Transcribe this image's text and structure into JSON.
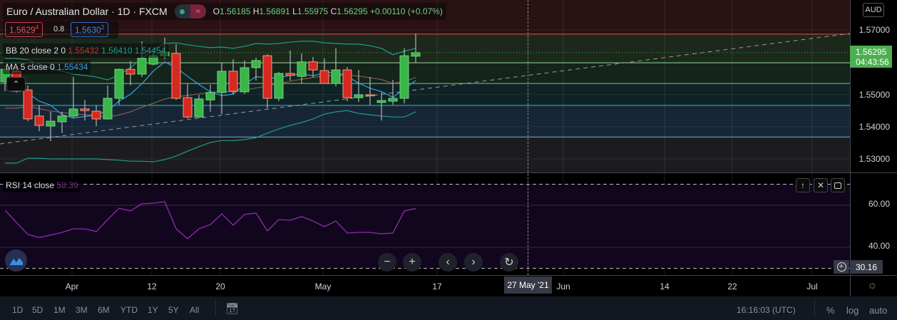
{
  "header": {
    "symbol": "Euro / Australian Dollar",
    "sep": "·",
    "interval": "1D",
    "exchange": "FXCM",
    "ohlc": {
      "o_label": "O",
      "o": "1.56185",
      "h_label": "H",
      "h": "1.56891",
      "l_label": "L",
      "l": "1.55975",
      "c_label": "C",
      "c": "1.56295",
      "change": "+0.00110 (+0.07%)"
    }
  },
  "quote": {
    "bid": "1.5629",
    "bid_sup": "4",
    "spread": "0.8",
    "ask": "1.5630",
    "ask_sup": "2"
  },
  "indicators": {
    "bb": {
      "label": "BB 20 close 2 0",
      "basis": "1.55432",
      "upper": "1.56410",
      "lower": "1.54454"
    },
    "ma": {
      "label": "MA 5 close 0",
      "value": "1.55434"
    },
    "rsi": {
      "label": "RSI 14 close",
      "value": "58.39"
    }
  },
  "price_axis": {
    "currency": "AUD",
    "ticks": [
      "1.57000",
      "1.55000",
      "1.54000",
      "1.53000"
    ],
    "last_price": "1.56295",
    "countdown": "04:43:56"
  },
  "rsi_axis": {
    "ticks": [
      "60.00",
      "40.00"
    ],
    "crosshair_value": "30.16"
  },
  "time_axis": {
    "ticks": [
      "Apr",
      "12",
      "20",
      "May",
      "17",
      "Jun",
      "14",
      "22",
      "Jul"
    ],
    "crosshair_date": "27 May '21"
  },
  "toolbar": {
    "ranges": [
      "1D",
      "5D",
      "1M",
      "3M",
      "6M",
      "YTD",
      "1Y",
      "5Y",
      "All"
    ],
    "clock": "16:16:03 (UTC)",
    "percent": "%",
    "log": "log",
    "auto": "auto"
  },
  "colors": {
    "up": "#3ab54a",
    "down": "#d42a22",
    "rsi": "#9b2fb5",
    "ma": "#3a9fe0",
    "bb": "#1f9c8c",
    "accent": "#4caf50"
  },
  "levels": [
    1.5687,
    1.5598,
    1.5534,
    1.5466,
    1.5368
  ],
  "candles": [
    [
      1.5539,
      1.559,
      1.551,
      1.5578
    ],
    [
      1.5572,
      1.558,
      1.5506,
      1.551
    ],
    [
      1.5514,
      1.5528,
      1.5417,
      1.5424
    ],
    [
      1.5433,
      1.5466,
      1.5386,
      1.5404
    ],
    [
      1.5402,
      1.5446,
      1.5355,
      1.5417
    ],
    [
      1.5415,
      1.5446,
      1.538,
      1.5433
    ],
    [
      1.5433,
      1.5554,
      1.5428,
      1.5455
    ],
    [
      1.5455,
      1.5483,
      1.5419,
      1.545
    ],
    [
      1.5448,
      1.5466,
      1.5402,
      1.5424
    ],
    [
      1.5424,
      1.5528,
      1.5422,
      1.5488
    ],
    [
      1.5488,
      1.558,
      1.5468,
      1.5578
    ],
    [
      1.5578,
      1.5603,
      1.5528,
      1.5563
    ],
    [
      1.5563,
      1.5665,
      1.5554,
      1.5612
    ],
    [
      1.5594,
      1.5634,
      1.559,
      1.562
    ],
    [
      1.562,
      1.5676,
      1.5609,
      1.5631
    ],
    [
      1.5627,
      1.5656,
      1.5483,
      1.5488
    ],
    [
      1.549,
      1.5534,
      1.5426,
      1.543
    ],
    [
      1.543,
      1.5499,
      1.5428,
      1.5486
    ],
    [
      1.5483,
      1.553,
      1.5446,
      1.5506
    ],
    [
      1.5506,
      1.5598,
      1.5439,
      1.5572
    ],
    [
      1.5572,
      1.5609,
      1.5501,
      1.551
    ],
    [
      1.5508,
      1.5605,
      1.5501,
      1.5583
    ],
    [
      1.5583,
      1.5614,
      1.5543,
      1.5605
    ],
    [
      1.562,
      1.5625,
      1.5457,
      1.5488
    ],
    [
      1.5488,
      1.557,
      1.5479,
      1.5565
    ],
    [
      1.5565,
      1.5636,
      1.5543,
      1.5559
    ],
    [
      1.5556,
      1.5627,
      1.5534,
      1.5601
    ],
    [
      1.5601,
      1.5616,
      1.5554,
      1.5576
    ],
    [
      1.5574,
      1.5612,
      1.5534,
      1.5534
    ],
    [
      1.5534,
      1.5643,
      1.5525,
      1.5576
    ],
    [
      1.5576,
      1.5585,
      1.5479,
      1.549
    ],
    [
      1.549,
      1.5576,
      1.5477,
      1.5499
    ],
    [
      1.5499,
      1.5554,
      1.5466,
      1.5497
    ],
    [
      1.5475,
      1.5506,
      1.5419,
      1.5481
    ],
    [
      1.5479,
      1.5545,
      1.5468,
      1.5488
    ],
    [
      1.5488,
      1.5643,
      1.5472,
      1.562
    ],
    [
      1.56185,
      1.56891,
      1.55975,
      1.56295
    ]
  ],
  "bb_upper": [
    1.5612,
    1.5612,
    1.5607,
    1.5594,
    1.5581,
    1.5572,
    1.5563,
    1.5559,
    1.5554,
    1.5545,
    1.5561,
    1.5583,
    1.5612,
    1.5638,
    1.5658,
    1.566,
    1.5654,
    1.5649,
    1.5645,
    1.5647,
    1.5643,
    1.5649,
    1.5658,
    1.5656,
    1.5658,
    1.5662,
    1.5665,
    1.5665,
    1.566,
    1.5658,
    1.5656,
    1.5656,
    1.5651,
    1.5643,
    1.5623,
    1.5634,
    1.5643
  ],
  "bb_lower": [
    1.5287,
    1.5287,
    1.5302,
    1.5302,
    1.53,
    1.53,
    1.53,
    1.53,
    1.53,
    1.5298,
    1.5296,
    1.5293,
    1.5293,
    1.5291,
    1.5298,
    1.5309,
    1.5324,
    1.5338,
    1.5351,
    1.5357,
    1.5357,
    1.536,
    1.5366,
    1.538,
    1.5393,
    1.5404,
    1.5413,
    1.5424,
    1.5439,
    1.5446,
    1.545,
    1.5441,
    1.5437,
    1.5433,
    1.543,
    1.543,
    1.5446
  ],
  "rsi_values": [
    57.6,
    51.9,
    46.1,
    44.7,
    45.8,
    47.1,
    48.8,
    48.8,
    47.5,
    53.2,
    58.6,
    57.3,
    60.7,
    61.0,
    61.7,
    48.8,
    44.1,
    48.8,
    50.8,
    55.9,
    50.5,
    55.6,
    56.3,
    47.8,
    53.2,
    52.9,
    54.6,
    52.5,
    49.8,
    52.5,
    46.8,
    47.1,
    47.1,
    46.4,
    46.8,
    57.3,
    58.39
  ]
}
